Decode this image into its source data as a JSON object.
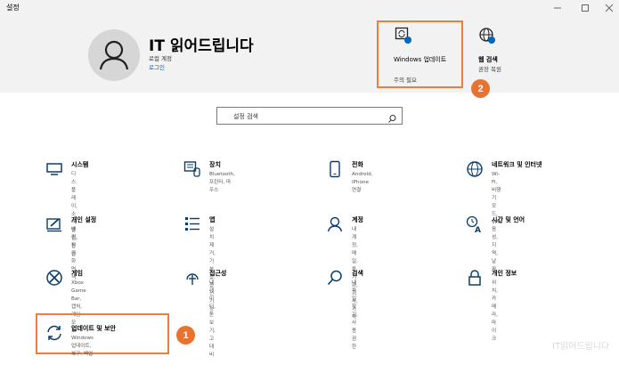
{
  "window": {
    "title": "설정",
    "minimize_icon": "minimize-icon",
    "maximize_icon": "maximize-icon",
    "close_icon": "close-icon"
  },
  "account": {
    "name": "IT 읽어드립니다",
    "type": "로컬 계정",
    "login_link": "로그인"
  },
  "header_tiles": [
    {
      "title": "Windows 업데이트",
      "status": "주의 필요",
      "icon": "windows-update-icon"
    },
    {
      "title": "웹 검색",
      "status": "권장 복원",
      "icon": "globe-icon"
    }
  ],
  "search": {
    "placeholder": "설정 검색",
    "icon": "search-icon"
  },
  "categories": [
    {
      "label": "시스템",
      "desc": "디스플레이, 소리, 알림, 전원",
      "icon": "monitor-icon"
    },
    {
      "label": "장치",
      "desc": "Bluetooth, 프린터, 마우스",
      "icon": "devices-icon"
    },
    {
      "label": "전화",
      "desc": "Android, iPhone 연결",
      "icon": "phone-icon"
    },
    {
      "label": "네트워크 및 인터넷",
      "desc": "Wi-Fi, 비행기 모드, VPN",
      "icon": "network-globe-icon"
    },
    {
      "label": "개인 설정",
      "desc": "배경, 잠금 화면, 색",
      "icon": "personalization-icon"
    },
    {
      "label": "앱",
      "desc": "설치 제거, 기본값, 옵션 기능",
      "icon": "apps-list-icon"
    },
    {
      "label": "계정",
      "desc1": "내 계정, 메일, 동기화, 회사, 가",
      "desc2": "족",
      "icon": "account-person-icon"
    },
    {
      "label": "시간 및 언어",
      "desc": "음성, 지역, 날짜",
      "icon": "time-language-icon"
    },
    {
      "label": "게임",
      "desc1": "Xbox Game Bar, 캡처, 게임 모",
      "desc2": "드",
      "icon": "xbox-icon"
    },
    {
      "label": "접근성",
      "desc": "내레이터, 돋보기, 고대비",
      "icon": "accessibility-icon"
    },
    {
      "label": "검색",
      "desc": "내 파일 찾기, 사용 권한",
      "icon": "search-icon"
    },
    {
      "label": "개인 정보",
      "desc": "위치, 카메라, 마이크",
      "icon": "lock-icon"
    },
    {
      "label": "업데이트 및 보안",
      "desc": "Windows 업데이트, 복구, 백업",
      "icon": "sync-icon"
    }
  ],
  "annotations": {
    "badge1": "1",
    "badge2": "2"
  },
  "watermark": "IT읽어드립니다",
  "colors": {
    "accent": "#0067c0",
    "highlight": "#ef7c3c",
    "badge": "#e8722f"
  }
}
